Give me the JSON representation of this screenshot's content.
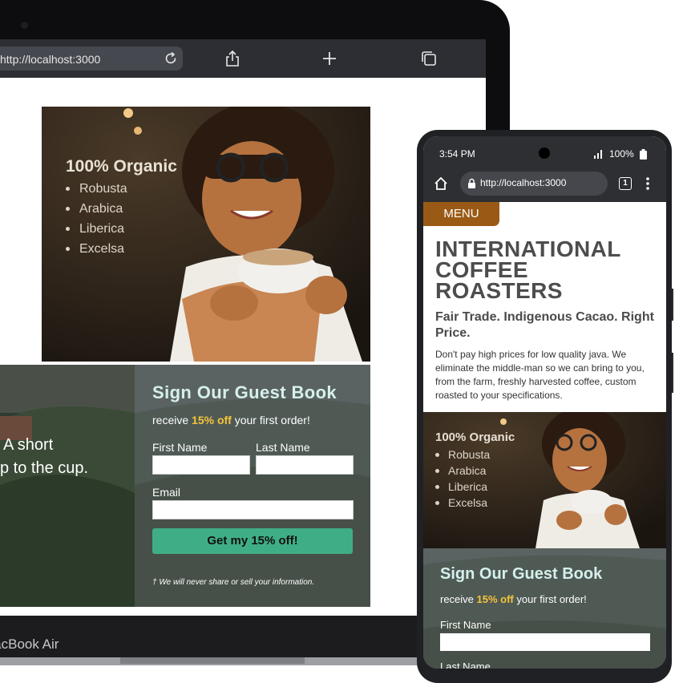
{
  "laptop": {
    "url": "http://localhost:3000",
    "brand": "MacBook Air",
    "hero": {
      "organic_title": "100% Organic",
      "beans": [
        "Robusta",
        "Arabica",
        "Liberica",
        "Excelsa"
      ]
    },
    "farm_text_line1": "A short",
    "farm_text_line2": "p to the cup.",
    "guestbook": {
      "title": "Sign Our Guest Book",
      "offer_prefix": "receive ",
      "offer_highlight": "15% off",
      "offer_suffix": " your first order!",
      "first_name_label": "First Name",
      "last_name_label": "Last Name",
      "email_label": "Email",
      "submit_label": "Get my 15% off!",
      "privacy_note": "† We will never share or sell your information."
    }
  },
  "phone": {
    "status": {
      "time": "3:54 PM",
      "battery": "100%"
    },
    "url": "http://localhost:3000",
    "tab_count": "1",
    "menu_label": "MENU",
    "title_lines": [
      "INTERNATIONAL",
      "COFFEE",
      "ROASTERS"
    ],
    "subtitle": "Fair Trade. Indigenous Cacao. Right Price.",
    "body": "Don't pay high prices for low quality java. We eliminate the middle-man so we can bring to you, from the farm, freshly harvested coffee, custom roasted to your specifications.",
    "hero": {
      "organic_title": "100% Organic",
      "beans": [
        "Robusta",
        "Arabica",
        "Liberica",
        "Excelsa"
      ]
    },
    "guestbook": {
      "title": "Sign Our Guest Book",
      "offer_prefix": "receive ",
      "offer_highlight": "15% off",
      "offer_suffix": " your first order!",
      "first_name_label": "First Name",
      "last_name_label": "Last Name"
    }
  },
  "colors": {
    "accent_green": "#3fae86",
    "highlight_yellow": "#f6c43a",
    "menu_brown": "#9a5a16",
    "title_mint": "#d6f0ec"
  }
}
